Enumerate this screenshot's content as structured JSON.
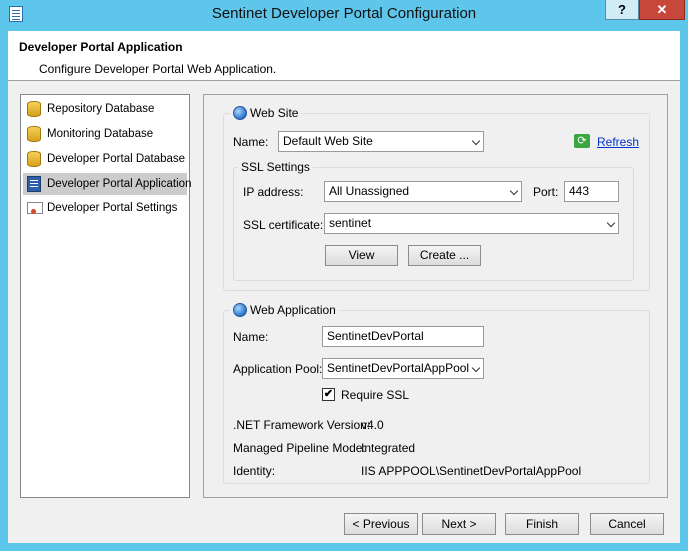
{
  "window": {
    "title": "Sentinet Developer Portal Configuration",
    "help_label": "?",
    "close_label": "✕"
  },
  "header": {
    "title": "Developer Portal Application",
    "subtitle": "Configure Developer Portal Web Application."
  },
  "nav": {
    "items": [
      {
        "label": "Repository Database",
        "icon": "database-icon",
        "selected": false
      },
      {
        "label": "Monitoring Database",
        "icon": "database-icon",
        "selected": false
      },
      {
        "label": "Developer Portal Database",
        "icon": "database-icon",
        "selected": false
      },
      {
        "label": "Developer Portal Application",
        "icon": "application-icon",
        "selected": true
      },
      {
        "label": "Developer Portal Settings",
        "icon": "certificate-icon",
        "selected": false
      }
    ]
  },
  "website": {
    "group_label": "Web Site",
    "name_label": "Name:",
    "name_value": "Default Web Site",
    "refresh_label": "Refresh",
    "ssl": {
      "group_label": "SSL Settings",
      "ip_label": "IP address:",
      "ip_value": "All Unassigned",
      "port_label": "Port:",
      "port_value": "443",
      "cert_label": "SSL certificate:",
      "cert_value": "sentinet",
      "view_label": "View",
      "create_label": "Create ..."
    }
  },
  "webapp": {
    "group_label": "Web Application",
    "name_label": "Name:",
    "name_value": "SentinetDevPortal",
    "pool_label": "Application Pool:",
    "pool_value": "SentinetDevPortalAppPool",
    "require_ssl_label": "Require SSL",
    "require_ssl_checked": true,
    "check_mark": "✔",
    "framework_label": ".NET Framework Version:",
    "framework_value": "v4.0",
    "pipeline_label": "Managed Pipeline Mode:",
    "pipeline_value": "Integrated",
    "identity_label": "Identity:",
    "identity_value": "IIS APPPOOL\\SentinetDevPortalAppPool"
  },
  "footer": {
    "previous_label": "< Previous",
    "next_label": "Next >",
    "finish_label": "Finish",
    "cancel_label": "Cancel"
  },
  "colors": {
    "titlebar": "#5ec6ea",
    "close_button": "#c7473a",
    "selected_nav": "#cccccc",
    "link": "#0033cc"
  }
}
